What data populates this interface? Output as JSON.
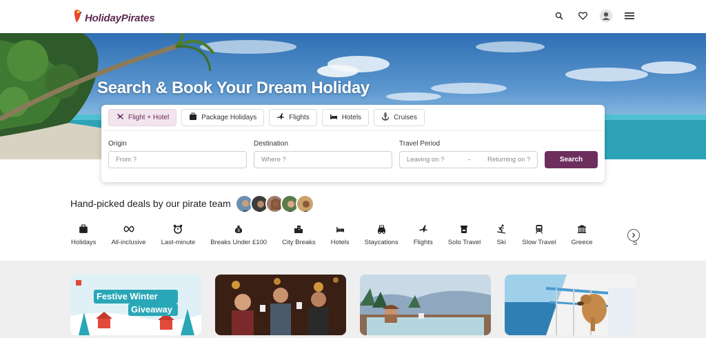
{
  "header": {
    "logo_text": "HolidayPirates",
    "icons": [
      "search-icon",
      "heart-icon",
      "user-icon",
      "menu-icon"
    ]
  },
  "hero": {
    "title": "Search & Book Your Dream Holiday"
  },
  "search": {
    "tabs": [
      {
        "label": "Flight + Hotel",
        "icon": "flight-hotel-icon",
        "active": true
      },
      {
        "label": "Package Holidays",
        "icon": "suitcase-icon",
        "active": false
      },
      {
        "label": "Flights",
        "icon": "plane-icon",
        "active": false
      },
      {
        "label": "Hotels",
        "icon": "bed-icon",
        "active": false
      },
      {
        "label": "Cruises",
        "icon": "anchor-icon",
        "active": false
      }
    ],
    "origin_label": "Origin",
    "origin_placeholder": "From ?",
    "destination_label": "Destination",
    "destination_placeholder": "Where ?",
    "period_label": "Travel Period",
    "leaving_placeholder": "Leaving on ?",
    "range_separator": "-",
    "returning_placeholder": "Returning on ?",
    "button_label": "Search"
  },
  "deals": {
    "title": "Hand-picked deals by our pirate team"
  },
  "categories": [
    {
      "label": "Holidays",
      "icon": "suitcase-icon"
    },
    {
      "label": "All-inclusive",
      "icon": "infinity-icon"
    },
    {
      "label": "Last-minute",
      "icon": "alarm-clock-icon"
    },
    {
      "label": "Breaks Under £100",
      "icon": "money-bag-icon"
    },
    {
      "label": "City Breaks",
      "icon": "city-icon"
    },
    {
      "label": "Hotels",
      "icon": "bed-icon"
    },
    {
      "label": "Staycations",
      "icon": "car-icon"
    },
    {
      "label": "Flights",
      "icon": "plane-icon"
    },
    {
      "label": "Solo Travel",
      "icon": "backpack-icon"
    },
    {
      "label": "Ski",
      "icon": "skier-icon"
    },
    {
      "label": "Slow Travel",
      "icon": "train-icon"
    },
    {
      "label": "Greece",
      "icon": "temple-icon"
    }
  ],
  "category_partial": "S",
  "cards": [
    {
      "line1": "Festive Winter",
      "line2": "Giveaway"
    }
  ],
  "colors": {
    "brand": "#6d2e5e",
    "tab_active_bg": "#f2e6ee"
  }
}
